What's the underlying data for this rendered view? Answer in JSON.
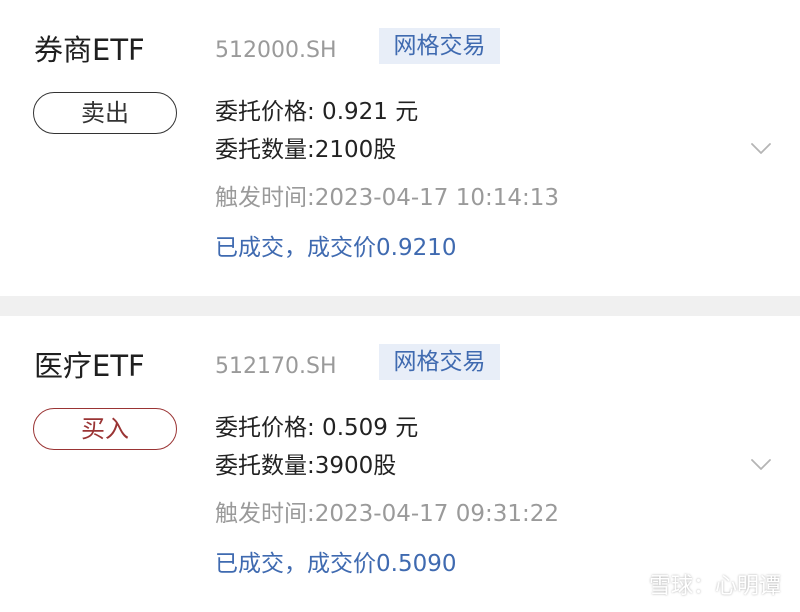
{
  "orders": [
    {
      "name": "券商ETF",
      "code": "512000.SH",
      "tag": "网格交易",
      "action": "卖出",
      "price_line": "委托价格: 0.921 元",
      "qty_line": "委托数量:2100股",
      "time_line": "触发时间:2023-04-17 10:14:13",
      "status_line": "已成交，成交价0.9210"
    },
    {
      "name": "医疗ETF",
      "code": "512170.SH",
      "tag": "网格交易",
      "action": "买入",
      "price_line": "委托价格: 0.509 元",
      "qty_line": "委托数量:3900股",
      "time_line": "触发时间:2023-04-17 09:31:22",
      "status_line": "已成交，成交价0.5090"
    }
  ],
  "watermark": {
    "text": "雪球：心明谭",
    "icon": "snowball-logo-icon"
  },
  "icons": {
    "expand": "chevron-down-icon"
  },
  "colors": {
    "accent_blue": "#3f6ab0",
    "tag_bg": "#e8eef8",
    "sell_border": "#333333",
    "buy_red": "#9a3434",
    "muted_gray": "#9a9a9a",
    "divider": "#f0f0f0"
  }
}
